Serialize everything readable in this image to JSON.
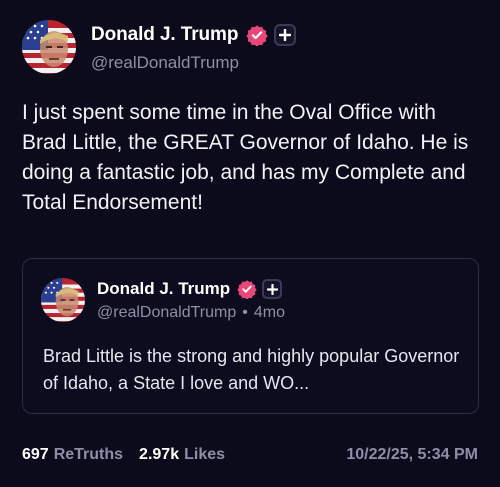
{
  "post": {
    "author": {
      "display_name": "Donald J. Trump",
      "handle": "@realDonaldTrump"
    },
    "text": "I just spent some time in the Oval Office with Brad Little, the GREAT Governor of Idaho. He is doing a fantastic job, and has my Complete and Total Endorsement!",
    "quote": {
      "author": {
        "display_name": "Donald J. Trump",
        "handle": "@realDonaldTrump"
      },
      "separator": "•",
      "age": "4mo",
      "text": "Brad Little is the strong and highly popular Governor of Idaho, a State I love and WO..."
    },
    "stats": {
      "retruths_count": "697",
      "retruths_label": "ReTruths",
      "likes_count": "2.97k",
      "likes_label": "Likes"
    },
    "timestamp": "10/22/25, 5:34 PM"
  },
  "colors": {
    "background": "#0c0b1c",
    "verified_badge": "#e8477a",
    "muted_text": "#8e8ea6"
  },
  "icons": {
    "verified": "verified-badge-icon",
    "plus": "plus-icon"
  }
}
